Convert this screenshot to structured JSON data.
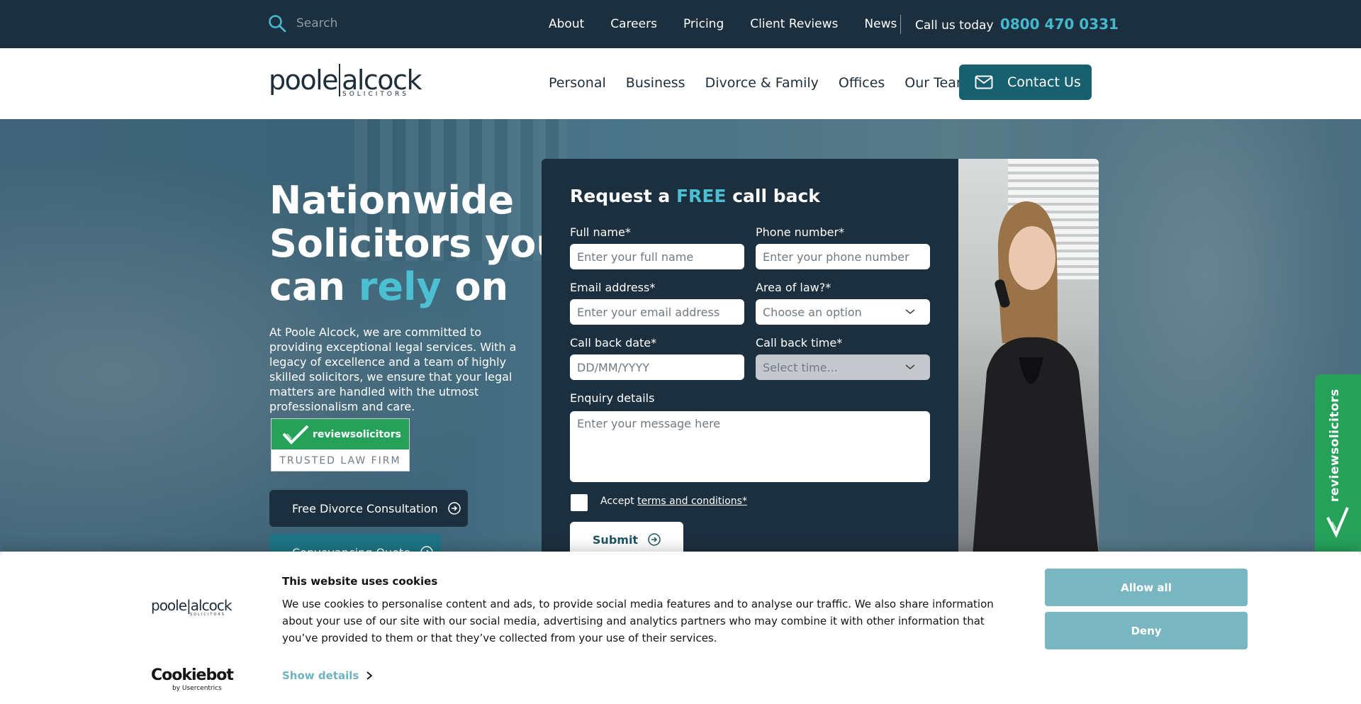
{
  "topbar": {
    "search_placeholder": "Search",
    "links": [
      "About",
      "Careers",
      "Pricing",
      "Client Reviews",
      "News"
    ],
    "call_label": "Call us today",
    "phone": "0800 470 0331"
  },
  "header": {
    "logo_left": "poole",
    "logo_right": "alcock",
    "logo_sub": "SOLICITORS",
    "nav": [
      "Personal",
      "Business",
      "Divorce & Family",
      "Offices",
      "Our Team"
    ],
    "contact_label": "Contact Us"
  },
  "hero": {
    "title_line1": "Nationwide",
    "title_line2": "Solicitors you",
    "title_can": "can",
    "title_rely": "rely",
    "title_on": "on",
    "text": "At Poole Alcock, we are committed to providing exceptional legal services. With a legacy of excellence and a team of highly skilled solicitors, we ensure that your legal matters are handled with the utmost professionalism and care.",
    "badge_brand": "reviewsolicitors",
    "badge_sub": "TRUSTED LAW FIRM",
    "btn_divorce": "Free Divorce Consultation",
    "btn_convey": "Conveyancing Quote"
  },
  "form": {
    "title_prefix": "Request a",
    "title_free": "FREE",
    "title_suffix": "call back",
    "full_name_label": "Full name*",
    "full_name_placeholder": "Enter your full name",
    "phone_label": "Phone number*",
    "phone_placeholder": "Enter your phone number",
    "email_label": "Email address*",
    "email_placeholder": "Enter your email address",
    "area_label": "Area of law?*",
    "area_value": "Choose an option",
    "date_label": "Call back date*",
    "date_placeholder": "DD/MM/YYYY",
    "time_label": "Call back time*",
    "time_value": "Select time...",
    "enquiry_label": "Enquiry details",
    "enquiry_placeholder": "Enter your message here",
    "accept_text": "Accept",
    "terms_link": "terms and conditions*",
    "submit_label": "Submit"
  },
  "side_tab": {
    "label": "reviewsolicitors"
  },
  "cookie": {
    "logo_left": "poole",
    "logo_right": "alcock",
    "logo_sub": "SOLICITORS",
    "cookiebot": "Cookiebot",
    "cookiebot_sub": "by Usercentrics",
    "title": "This website uses cookies",
    "body": "We use cookies to personalise content and ads, to provide social media features and to analyse our traffic. We also share information about your use of our site with our social media, advertising and analytics partners who may combine it with other information that you’ve provided to them or that they’ve collected from your use of their services.",
    "show_details": "Show details",
    "allow_all": "Allow all",
    "deny": "Deny"
  },
  "colors": {
    "navy": "#1c2f3e",
    "accent": "#44b9cd",
    "teal_button": "#16606f",
    "review_green": "#26a15a",
    "cookie_button": "#7ab6c1"
  }
}
